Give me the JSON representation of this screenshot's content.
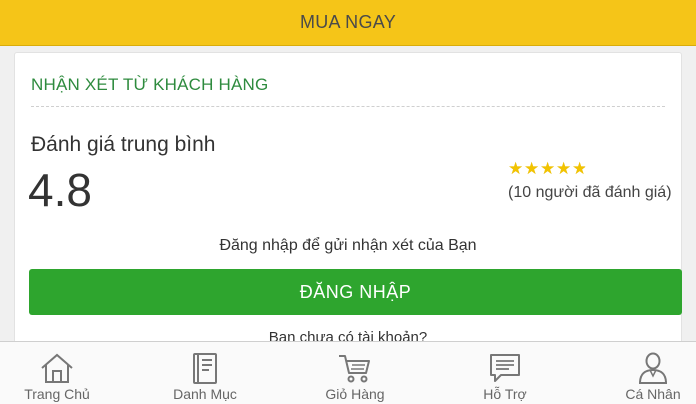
{
  "buy_bar": {
    "label": "MUA NGAY"
  },
  "reviews": {
    "title": "NHẬN XÉT TỪ KHÁCH HÀNG",
    "average_label": "Đánh giá trung bình",
    "average_value": "4.8",
    "rating_stars": 4.8,
    "review_count_text": "(10 người đã đánh giá)",
    "login_prompt": "Đăng nhập để gửi nhận xét của Bạn",
    "login_button": "ĐĂNG NHẬP",
    "no_account_text": "Bạn chưa có tài khoản?"
  },
  "bottom_nav": [
    {
      "label": "Trang Chủ",
      "icon": "home-icon"
    },
    {
      "label": "Danh Mục",
      "icon": "catalog-icon"
    },
    {
      "label": "Giỏ Hàng",
      "icon": "cart-icon"
    },
    {
      "label": "Hỗ Trợ",
      "icon": "chat-icon"
    },
    {
      "label": "Cá Nhân",
      "icon": "user-icon"
    }
  ],
  "colors": {
    "accent_yellow": "#f5c518",
    "primary_green": "#2ea52e",
    "title_green": "#2e8b3e",
    "star_gold": "#f2c300"
  }
}
